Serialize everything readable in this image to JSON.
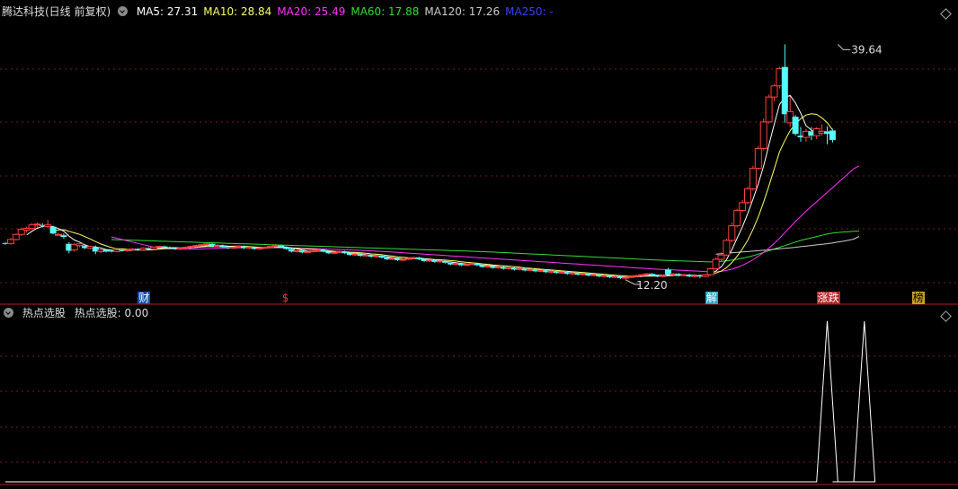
{
  "header": {
    "title": "腾达科技(日线 前复权)",
    "ma": [
      {
        "label": "MA5: 27.31",
        "color": "#ffffff"
      },
      {
        "label": "MA10: 28.84",
        "color": "#ffff66"
      },
      {
        "label": "MA20: 25.49",
        "color": "#ff33ff"
      },
      {
        "label": "MA60: 17.88",
        "color": "#33dd33"
      },
      {
        "label": "MA120: 17.26",
        "color": "#cccccc"
      },
      {
        "label": "MA250: -",
        "color": "#3344ff"
      }
    ]
  },
  "events": [
    {
      "text": "财",
      "bg": "#1a4fa8",
      "color": "#ffffff",
      "day": 26
    },
    {
      "text": "$",
      "bg": "transparent",
      "color": "#ff3333",
      "day": 53
    },
    {
      "text": "解",
      "bg": "#2aa6c8",
      "color": "#ffffff",
      "day": 133
    },
    {
      "text": "涨跌",
      "bg": "#b02828",
      "color": "#ffffff",
      "day": 154
    },
    {
      "text": "榜",
      "bg": "#c8a020",
      "color": "#000000",
      "day": 172
    }
  ],
  "indicator": {
    "title": "热点选股",
    "value_label": "热点选股: 0.00"
  },
  "chart_data": {
    "type": "candlestick",
    "xlabel": "",
    "ylabel": "",
    "ylim": [
      10.0,
      42.5
    ],
    "max_annotation": {
      "label": "39.64",
      "day": 157,
      "price": 39.64
    },
    "min_annotation": {
      "label": "12.20",
      "day": 117,
      "price": 12.2
    },
    "ohlc": [
      [
        16.5,
        16.6,
        16.3,
        16.45
      ],
      [
        16.45,
        17.1,
        16.3,
        16.9
      ],
      [
        16.9,
        17.6,
        16.8,
        17.5
      ],
      [
        17.5,
        18.3,
        17.3,
        18.1
      ],
      [
        18.0,
        18.4,
        17.7,
        18.2
      ],
      [
        18.2,
        18.8,
        18.0,
        18.6
      ],
      [
        18.6,
        18.9,
        18.3,
        18.7
      ],
      [
        18.6,
        18.8,
        18.3,
        18.5
      ],
      [
        18.4,
        19.2,
        18.2,
        18.6
      ],
      [
        18.4,
        18.5,
        17.5,
        17.6
      ],
      [
        17.5,
        17.7,
        17.4,
        17.5
      ],
      [
        17.4,
        17.6,
        17.0,
        17.2
      ],
      [
        16.4,
        16.6,
        15.3,
        15.6
      ],
      [
        15.7,
        16.5,
        15.5,
        16.3
      ],
      [
        16.2,
        16.5,
        16.0,
        16.4
      ],
      [
        16.2,
        16.3,
        15.8,
        15.9
      ],
      [
        15.9,
        16.2,
        15.8,
        16.1
      ],
      [
        16.0,
        16.2,
        15.2,
        15.5
      ],
      [
        15.5,
        15.8,
        15.3,
        15.7
      ],
      [
        15.7,
        15.8,
        15.4,
        15.5
      ],
      [
        15.6,
        15.7,
        15.4,
        15.5
      ],
      [
        15.5,
        15.8,
        15.4,
        15.7
      ],
      [
        15.7,
        15.8,
        15.5,
        15.6
      ],
      [
        15.6,
        15.8,
        15.5,
        15.7
      ],
      [
        15.7,
        15.9,
        15.6,
        15.8
      ],
      [
        15.8,
        15.9,
        15.6,
        15.7
      ],
      [
        15.7,
        16.0,
        15.6,
        15.9
      ],
      [
        15.9,
        16.0,
        15.7,
        15.8
      ],
      [
        15.8,
        16.1,
        15.7,
        16.0
      ],
      [
        16.0,
        16.2,
        15.9,
        16.1
      ],
      [
        16.1,
        16.2,
        15.9,
        16.0
      ],
      [
        16.0,
        16.1,
        15.8,
        15.9
      ],
      [
        15.9,
        16.0,
        15.7,
        15.8
      ],
      [
        15.8,
        16.0,
        15.7,
        15.9
      ],
      [
        15.9,
        16.1,
        15.8,
        16.0
      ],
      [
        16.0,
        16.2,
        15.9,
        16.1
      ],
      [
        16.1,
        16.3,
        16.0,
        16.2
      ],
      [
        16.2,
        16.4,
        16.1,
        16.3
      ],
      [
        16.3,
        16.5,
        16.2,
        16.4
      ],
      [
        16.4,
        16.5,
        16.0,
        16.1
      ],
      [
        16.1,
        16.3,
        16.0,
        16.2
      ],
      [
        16.2,
        16.3,
        15.9,
        16.0
      ],
      [
        16.0,
        16.1,
        15.8,
        15.9
      ],
      [
        15.9,
        16.1,
        15.8,
        16.0
      ],
      [
        16.0,
        16.2,
        15.9,
        16.1
      ],
      [
        16.1,
        16.2,
        15.8,
        15.9
      ],
      [
        15.9,
        16.1,
        15.8,
        16.0
      ],
      [
        16.0,
        16.1,
        15.7,
        15.8
      ],
      [
        15.8,
        16.0,
        15.7,
        15.9
      ],
      [
        15.9,
        16.1,
        15.8,
        16.0
      ],
      [
        16.0,
        16.2,
        15.9,
        16.1
      ],
      [
        16.1,
        16.4,
        16.0,
        16.2
      ],
      [
        16.2,
        16.3,
        15.9,
        16.0
      ],
      [
        16.0,
        16.1,
        15.7,
        15.8
      ],
      [
        15.8,
        15.9,
        15.4,
        15.5
      ],
      [
        15.5,
        15.7,
        15.4,
        15.6
      ],
      [
        15.6,
        15.7,
        15.3,
        15.4
      ],
      [
        15.4,
        15.6,
        15.3,
        15.5
      ],
      [
        15.5,
        15.7,
        15.4,
        15.6
      ],
      [
        15.6,
        15.8,
        15.5,
        15.7
      ],
      [
        15.7,
        15.8,
        15.4,
        15.5
      ],
      [
        15.5,
        15.6,
        15.2,
        15.3
      ],
      [
        15.3,
        15.5,
        15.2,
        15.4
      ],
      [
        15.4,
        15.6,
        15.3,
        15.5
      ],
      [
        15.5,
        15.6,
        15.2,
        15.3
      ],
      [
        15.3,
        15.4,
        15.0,
        15.1
      ],
      [
        15.1,
        15.3,
        15.0,
        15.2
      ],
      [
        15.2,
        15.3,
        14.9,
        15.0
      ],
      [
        15.0,
        15.2,
        14.9,
        15.1
      ],
      [
        15.1,
        15.2,
        14.8,
        14.9
      ],
      [
        14.9,
        15.1,
        14.8,
        15.0
      ],
      [
        15.0,
        15.1,
        14.7,
        14.8
      ],
      [
        14.8,
        14.9,
        14.5,
        14.6
      ],
      [
        14.6,
        14.8,
        14.5,
        14.7
      ],
      [
        14.7,
        14.8,
        14.4,
        14.5
      ],
      [
        14.5,
        14.7,
        14.4,
        14.6
      ],
      [
        14.6,
        14.8,
        14.5,
        14.7
      ],
      [
        14.7,
        14.9,
        14.6,
        14.8
      ],
      [
        14.8,
        14.9,
        14.5,
        14.6
      ],
      [
        14.6,
        14.7,
        14.3,
        14.4
      ],
      [
        14.4,
        14.6,
        14.3,
        14.5
      ],
      [
        14.5,
        14.6,
        14.2,
        14.3
      ],
      [
        14.3,
        14.5,
        14.2,
        14.4
      ],
      [
        14.4,
        14.5,
        14.1,
        14.2
      ],
      [
        14.2,
        14.3,
        13.9,
        14.0
      ],
      [
        14.0,
        14.2,
        13.9,
        14.1
      ],
      [
        14.1,
        14.2,
        13.8,
        13.9
      ],
      [
        13.9,
        14.1,
        13.8,
        14.0
      ],
      [
        14.0,
        14.2,
        13.9,
        14.1
      ],
      [
        14.1,
        14.2,
        13.8,
        13.9
      ],
      [
        13.9,
        14.0,
        13.6,
        13.7
      ],
      [
        13.7,
        13.9,
        13.6,
        13.8
      ],
      [
        13.8,
        13.9,
        13.5,
        13.6
      ],
      [
        13.6,
        13.8,
        13.5,
        13.7
      ],
      [
        13.7,
        13.8,
        13.4,
        13.5
      ],
      [
        13.5,
        13.7,
        13.4,
        13.6
      ],
      [
        13.6,
        13.7,
        13.3,
        13.4
      ],
      [
        13.4,
        13.6,
        13.3,
        13.5
      ],
      [
        13.5,
        13.6,
        13.2,
        13.3
      ],
      [
        13.3,
        13.5,
        13.2,
        13.4
      ],
      [
        13.4,
        13.5,
        13.1,
        13.2
      ],
      [
        13.2,
        13.4,
        13.1,
        13.3
      ],
      [
        13.3,
        13.4,
        13.0,
        13.1
      ],
      [
        13.1,
        13.3,
        13.0,
        13.2
      ],
      [
        13.2,
        13.3,
        12.9,
        13.0
      ],
      [
        13.0,
        13.2,
        12.9,
        13.1
      ],
      [
        13.1,
        13.2,
        12.8,
        12.9
      ],
      [
        12.9,
        13.1,
        12.8,
        13.0
      ],
      [
        13.0,
        13.1,
        12.7,
        12.8
      ],
      [
        12.8,
        13.0,
        12.7,
        12.9
      ],
      [
        12.9,
        13.0,
        12.6,
        12.7
      ],
      [
        12.7,
        12.9,
        12.6,
        12.8
      ],
      [
        12.8,
        12.9,
        12.5,
        12.6
      ],
      [
        12.6,
        12.8,
        12.5,
        12.7
      ],
      [
        12.7,
        12.8,
        12.4,
        12.5
      ],
      [
        12.5,
        12.7,
        12.4,
        12.6
      ],
      [
        12.6,
        12.7,
        12.3,
        12.4
      ],
      [
        12.4,
        12.6,
        12.2,
        12.5
      ],
      [
        12.5,
        12.7,
        12.4,
        12.6
      ],
      [
        12.6,
        12.8,
        12.5,
        12.7
      ],
      [
        12.7,
        12.9,
        12.6,
        12.8
      ],
      [
        12.8,
        13.0,
        12.7,
        12.9
      ],
      [
        12.9,
        13.0,
        12.6,
        12.7
      ],
      [
        12.7,
        12.8,
        12.5,
        12.6
      ],
      [
        12.6,
        12.8,
        12.5,
        12.7
      ],
      [
        13.4,
        13.6,
        12.7,
        12.8
      ],
      [
        12.8,
        13.0,
        12.6,
        12.9
      ],
      [
        12.9,
        13.0,
        12.6,
        12.7
      ],
      [
        12.7,
        12.9,
        12.6,
        12.8
      ],
      [
        12.8,
        12.9,
        12.5,
        12.6
      ],
      [
        12.6,
        12.8,
        12.5,
        12.7
      ],
      [
        12.7,
        12.8,
        12.4,
        12.6
      ],
      [
        12.6,
        12.9,
        12.5,
        12.8
      ],
      [
        12.8,
        13.6,
        12.7,
        13.5
      ],
      [
        13.5,
        14.8,
        13.4,
        14.6
      ],
      [
        14.6,
        15.4,
        14.3,
        15.1
      ],
      [
        15.1,
        17.0,
        15.0,
        16.8
      ],
      [
        16.8,
        18.9,
        16.6,
        18.5
      ],
      [
        18.5,
        20.5,
        18.3,
        20.3
      ],
      [
        20.3,
        21.5,
        20.1,
        21.2
      ],
      [
        21.2,
        23.1,
        21.0,
        22.8
      ],
      [
        22.8,
        25.5,
        22.6,
        25.2
      ],
      [
        25.2,
        27.8,
        25.0,
        27.5
      ],
      [
        27.5,
        31.0,
        27.3,
        30.6
      ],
      [
        30.6,
        33.8,
        30.4,
        33.5
      ],
      [
        33.5,
        35.0,
        33.0,
        34.8
      ],
      [
        34.8,
        37.0,
        34.5,
        36.8
      ],
      [
        37.0,
        39.64,
        30.5,
        31.5
      ],
      [
        30.5,
        33.5,
        30.0,
        31.8
      ],
      [
        31.2,
        31.4,
        29.0,
        29.2
      ],
      [
        29.0,
        30.0,
        28.3,
        28.8
      ],
      [
        28.8,
        29.8,
        28.3,
        29.5
      ],
      [
        29.5,
        30.0,
        28.5,
        29.0
      ],
      [
        29.0,
        30.0,
        28.6,
        29.8
      ],
      [
        29.3,
        30.3,
        29.0,
        29.5
      ],
      [
        29.5,
        30.1,
        28.0,
        29.2
      ],
      [
        29.6,
        29.8,
        28.2,
        28.5
      ]
    ],
    "ma20": [
      null,
      null,
      null,
      null,
      null,
      null,
      null,
      null,
      null,
      null,
      null,
      null,
      null,
      null,
      null,
      null,
      null,
      null,
      null,
      null,
      17.2,
      17.05,
      16.9,
      16.75,
      16.6,
      16.45,
      16.3,
      16.15,
      16.0,
      15.9,
      15.85,
      15.82,
      15.8,
      15.78,
      15.77,
      15.77,
      15.78,
      15.8,
      15.82,
      15.85,
      15.88,
      15.9,
      15.92,
      15.93,
      15.94,
      15.95,
      15.96,
      15.96,
      15.96,
      15.96,
      15.96,
      15.96,
      15.95,
      15.94,
      15.92,
      15.9,
      15.88,
      15.86,
      15.84,
      15.82,
      15.8,
      15.78,
      15.76,
      15.74,
      15.72,
      15.7,
      15.67,
      15.64,
      15.61,
      15.58,
      15.55,
      15.52,
      15.48,
      15.44,
      15.4,
      15.36,
      15.32,
      15.28,
      15.24,
      15.2,
      15.16,
      15.12,
      15.08,
      15.04,
      15.0,
      14.96,
      14.92,
      14.88,
      14.84,
      14.8,
      14.76,
      14.72,
      14.68,
      14.64,
      14.6,
      14.56,
      14.52,
      14.48,
      14.44,
      14.4,
      14.36,
      14.32,
      14.28,
      14.24,
      14.2,
      14.16,
      14.12,
      14.08,
      14.04,
      14.0,
      13.96,
      13.92,
      13.88,
      13.84,
      13.8,
      13.76,
      13.72,
      13.68,
      13.64,
      13.6,
      13.56,
      13.52,
      13.48,
      13.45,
      13.42,
      13.39,
      13.36,
      13.33,
      13.3,
      13.27,
      13.24,
      13.21,
      13.18,
      13.15,
      13.15,
      13.2,
      13.3,
      13.45,
      13.65,
      13.9,
      14.2,
      14.55,
      14.95,
      15.4,
      15.9,
      16.45,
      17.05,
      17.7,
      18.35,
      19.0,
      19.6,
      20.2,
      20.75,
      21.3,
      21.85,
      22.4,
      22.95,
      23.5,
      24.05,
      24.6,
      25.15,
      25.49
    ],
    "ma60": [
      null,
      null,
      null,
      null,
      null,
      null,
      null,
      null,
      null,
      null,
      null,
      null,
      null,
      null,
      null,
      null,
      null,
      null,
      null,
      null,
      16.9,
      16.88,
      16.86,
      16.84,
      16.82,
      16.8,
      16.78,
      16.76,
      16.74,
      16.72,
      16.7,
      16.68,
      16.66,
      16.64,
      16.62,
      16.6,
      16.58,
      16.56,
      16.54,
      16.52,
      16.5,
      16.48,
      16.46,
      16.44,
      16.42,
      16.4,
      16.38,
      16.36,
      16.34,
      16.32,
      16.3,
      16.28,
      16.26,
      16.24,
      16.22,
      16.2,
      16.18,
      16.16,
      16.14,
      16.12,
      16.1,
      16.08,
      16.06,
      16.04,
      16.02,
      16.0,
      15.98,
      15.96,
      15.94,
      15.92,
      15.9,
      15.88,
      15.86,
      15.84,
      15.82,
      15.8,
      15.78,
      15.76,
      15.74,
      15.72,
      15.7,
      15.68,
      15.66,
      15.64,
      15.62,
      15.6,
      15.58,
      15.56,
      15.54,
      15.52,
      15.5,
      15.47,
      15.44,
      15.41,
      15.38,
      15.35,
      15.32,
      15.29,
      15.26,
      15.23,
      15.2,
      15.17,
      15.14,
      15.11,
      15.08,
      15.05,
      15.02,
      14.99,
      14.96,
      14.93,
      14.9,
      14.87,
      14.84,
      14.81,
      14.78,
      14.75,
      14.72,
      14.69,
      14.66,
      14.63,
      14.6,
      14.57,
      14.54,
      14.51,
      14.48,
      14.46,
      14.44,
      14.42,
      14.4,
      14.38,
      14.36,
      14.34,
      14.32,
      14.3,
      14.32,
      14.36,
      14.42,
      14.5,
      14.6,
      14.72,
      14.86,
      15.02,
      15.2,
      15.4,
      15.6,
      15.8,
      16.0,
      16.2,
      16.4,
      16.6,
      16.8,
      16.95,
      17.1,
      17.25,
      17.4,
      17.55,
      17.65,
      17.72,
      17.78,
      17.82,
      17.86,
      17.88
    ],
    "ma120": [
      null,
      null,
      null,
      null,
      null,
      null,
      null,
      null,
      null,
      null,
      null,
      null,
      null,
      null,
      null,
      null,
      null,
      null,
      null,
      null,
      null,
      null,
      null,
      null,
      null,
      null,
      null,
      null,
      null,
      null,
      null,
      null,
      null,
      null,
      null,
      null,
      null,
      null,
      null,
      null,
      null,
      null,
      null,
      null,
      null,
      null,
      null,
      null,
      null,
      null,
      null,
      null,
      null,
      null,
      null,
      null,
      null,
      null,
      null,
      null,
      null,
      null,
      null,
      null,
      null,
      null,
      null,
      null,
      null,
      null,
      null,
      null,
      null,
      null,
      null,
      null,
      null,
      null,
      null,
      null,
      null,
      null,
      null,
      null,
      null,
      null,
      null,
      null,
      null,
      null,
      null,
      null,
      null,
      null,
      null,
      null,
      null,
      null,
      null,
      null,
      null,
      null,
      null,
      null,
      null,
      null,
      null,
      null,
      null,
      null,
      null,
      null,
      null,
      null,
      null,
      null,
      null,
      null,
      null,
      null,
      null,
      null,
      null,
      null,
      null,
      null,
      null,
      null,
      null,
      null,
      null,
      null,
      null,
      null,
      15.2,
      15.25,
      15.3,
      15.35,
      15.4,
      15.45,
      15.5,
      15.55,
      15.6,
      15.65,
      15.7,
      15.76,
      15.82,
      15.88,
      15.94,
      16.0,
      16.07,
      16.14,
      16.21,
      16.28,
      16.35,
      16.42,
      16.5,
      16.6,
      16.7,
      16.82,
      16.95,
      17.26
    ],
    "indicator": {
      "type": "line",
      "ylim": [
        0,
        1
      ],
      "signal_days": [
        155,
        162
      ],
      "series_value_note": "0 except spikes to 1 on signal days"
    }
  }
}
